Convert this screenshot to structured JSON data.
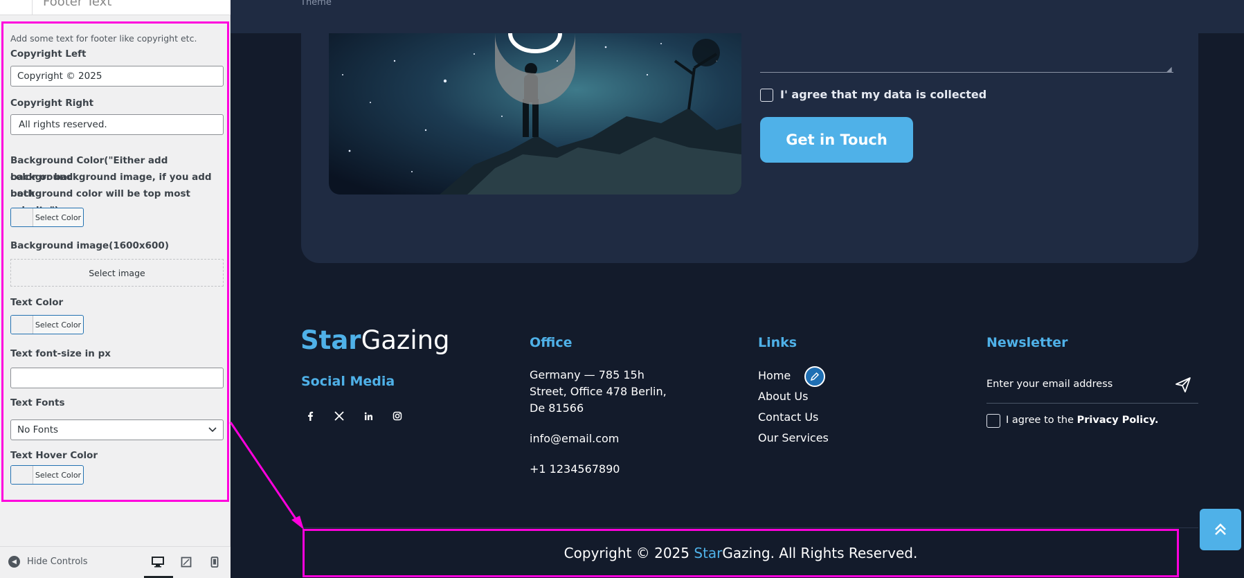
{
  "panel": {
    "header_title": "Footer Text",
    "description": "Add some text for footer like copyright etc.",
    "copyright_left_label": "Copyright Left",
    "copyright_left_value": "Copyright © 2025",
    "copyright_right_label": "Copyright Right",
    "copyright_right_value": "All rights reserved.",
    "bg_color_label_1": "Background Color(\"Either add background",
    "bg_color_label_2": "color or background image, if you add both",
    "bg_color_label_3": "background color will be top most priority\")",
    "select_color": "Select Color",
    "bg_image_label": "Background image(1600x600)",
    "select_image": "Select image",
    "text_color_label": "Text Color",
    "font_size_label": "Text font-size in px",
    "font_size_value": "",
    "text_fonts_label": "Text Fonts",
    "text_fonts_value": "No Fonts",
    "hover_color_label": "Text Hover Color",
    "hide_controls": "Hide Controls"
  },
  "preview": {
    "topbar_theme": "Theme",
    "agree_text": "I' agree that my data is collected",
    "get_in_touch": "Get in Touch",
    "logo_star": "Star",
    "logo_gazing": "Gazing",
    "social_heading": "Social Media",
    "office_heading": "Office",
    "office_address_1": "Germany — 785 15h",
    "office_address_2": "Street, Office 478 Berlin,",
    "office_address_3": "De 81566",
    "office_email": "info@email.com",
    "office_phone": "+1 1234567890",
    "links_heading": "Links",
    "links": [
      "Home",
      "About Us",
      "Contact Us",
      "Our Services"
    ],
    "newsletter_heading": "Newsletter",
    "newsletter_placeholder": "Enter your email address",
    "privacy_prefix": "I agree to the",
    "privacy_link": "Privacy Policy.",
    "copyright_prefix": "Copyright © 2025",
    "copyright_star": "Star",
    "copyright_rest": "Gazing. All Rights Reserved."
  },
  "colors": {
    "accent": "#4fb1e8",
    "highlight": "#ff00dd",
    "footer_bg": "#131b2b",
    "card_bg": "#1f2b42"
  }
}
